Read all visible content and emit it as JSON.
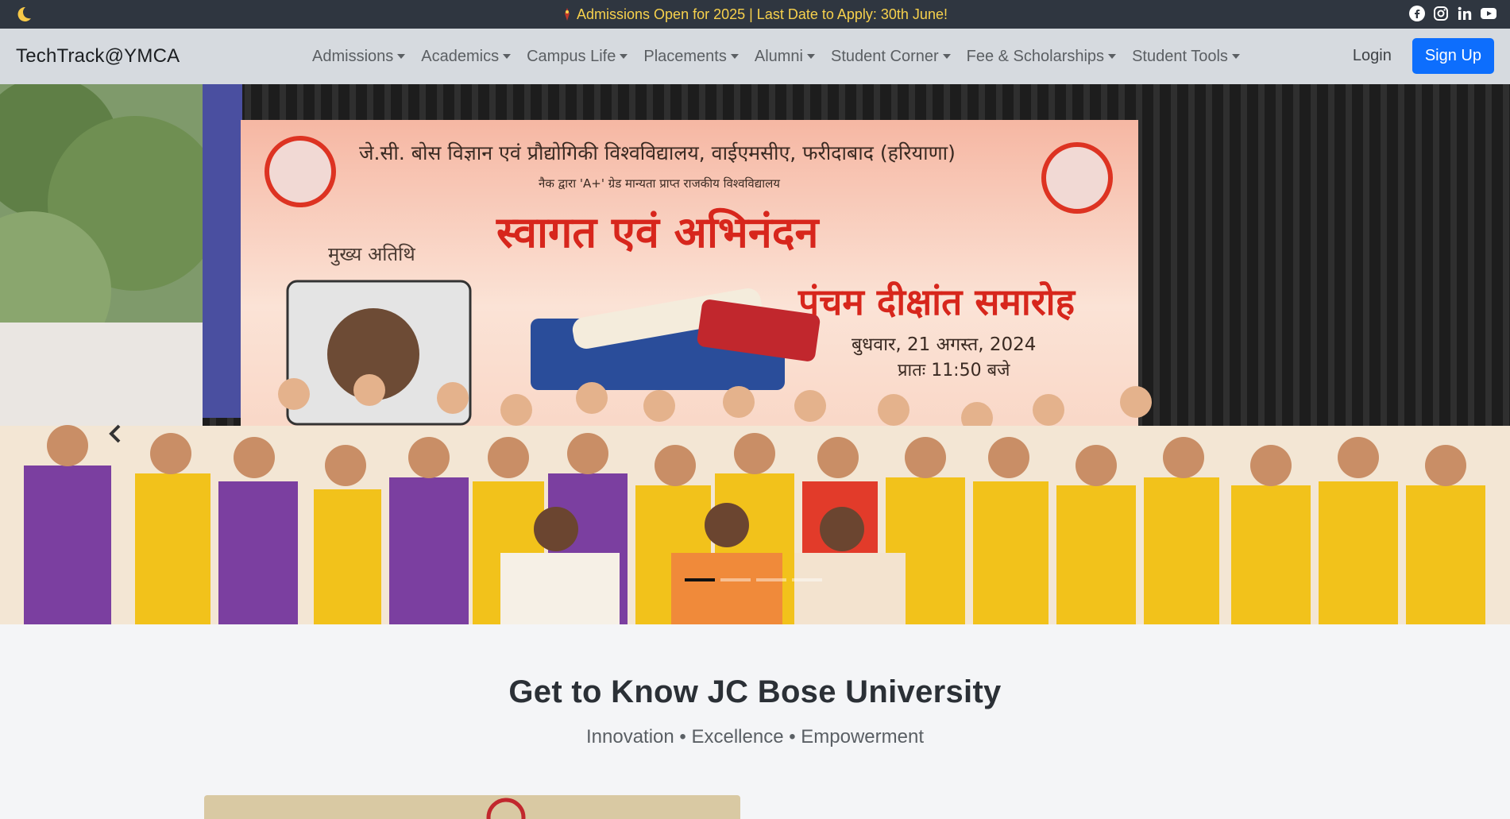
{
  "topbar": {
    "theme_icon": "moon-icon",
    "announcement": "Admissions Open for 2025 | Last Date to Apply: 30th June!",
    "social": [
      "facebook-icon",
      "instagram-icon",
      "linkedin-icon",
      "youtube-icon"
    ]
  },
  "navbar": {
    "brand": "TechTrack@YMCA",
    "links": [
      {
        "label": "Admissions"
      },
      {
        "label": "Academics"
      },
      {
        "label": "Campus Life"
      },
      {
        "label": "Placements"
      },
      {
        "label": "Alumni"
      },
      {
        "label": "Student Corner"
      },
      {
        "label": "Fee & Scholarships"
      },
      {
        "label": "Student Tools"
      }
    ],
    "login": "Login",
    "signup": "Sign Up"
  },
  "hero": {
    "banner_line1": "जे.सी. बोस विज्ञान एवं प्रौद्योगिकी विश्वविद्यालय, वाईएमसीए, फरीदाबाद (हरियाणा)",
    "banner_line2": "नैक द्वारा 'A+' ग्रेड मान्यता प्राप्त राजकीय विश्वविद्यालय",
    "banner_welcome": "स्वागत एवं अभिनंदन",
    "banner_chief_guest": "मुख्य अतिथि",
    "banner_event": "पंचम दीक्षांत समारोह",
    "banner_date": "बुधवार, 21 अगस्त, 2024",
    "banner_time": "प्रातः 11:50 बजे",
    "slide_count": 4,
    "active_slide": 1
  },
  "about": {
    "title": "Get to Know JC Bose University",
    "tagline": "Innovation • Excellence • Empowerment"
  },
  "colors": {
    "topbar_bg": "#2f3640",
    "announcement": "#f7d14c",
    "navbar_bg": "#d6dadf",
    "primary": "#0d6efd",
    "banner_red": "#d7261c"
  }
}
